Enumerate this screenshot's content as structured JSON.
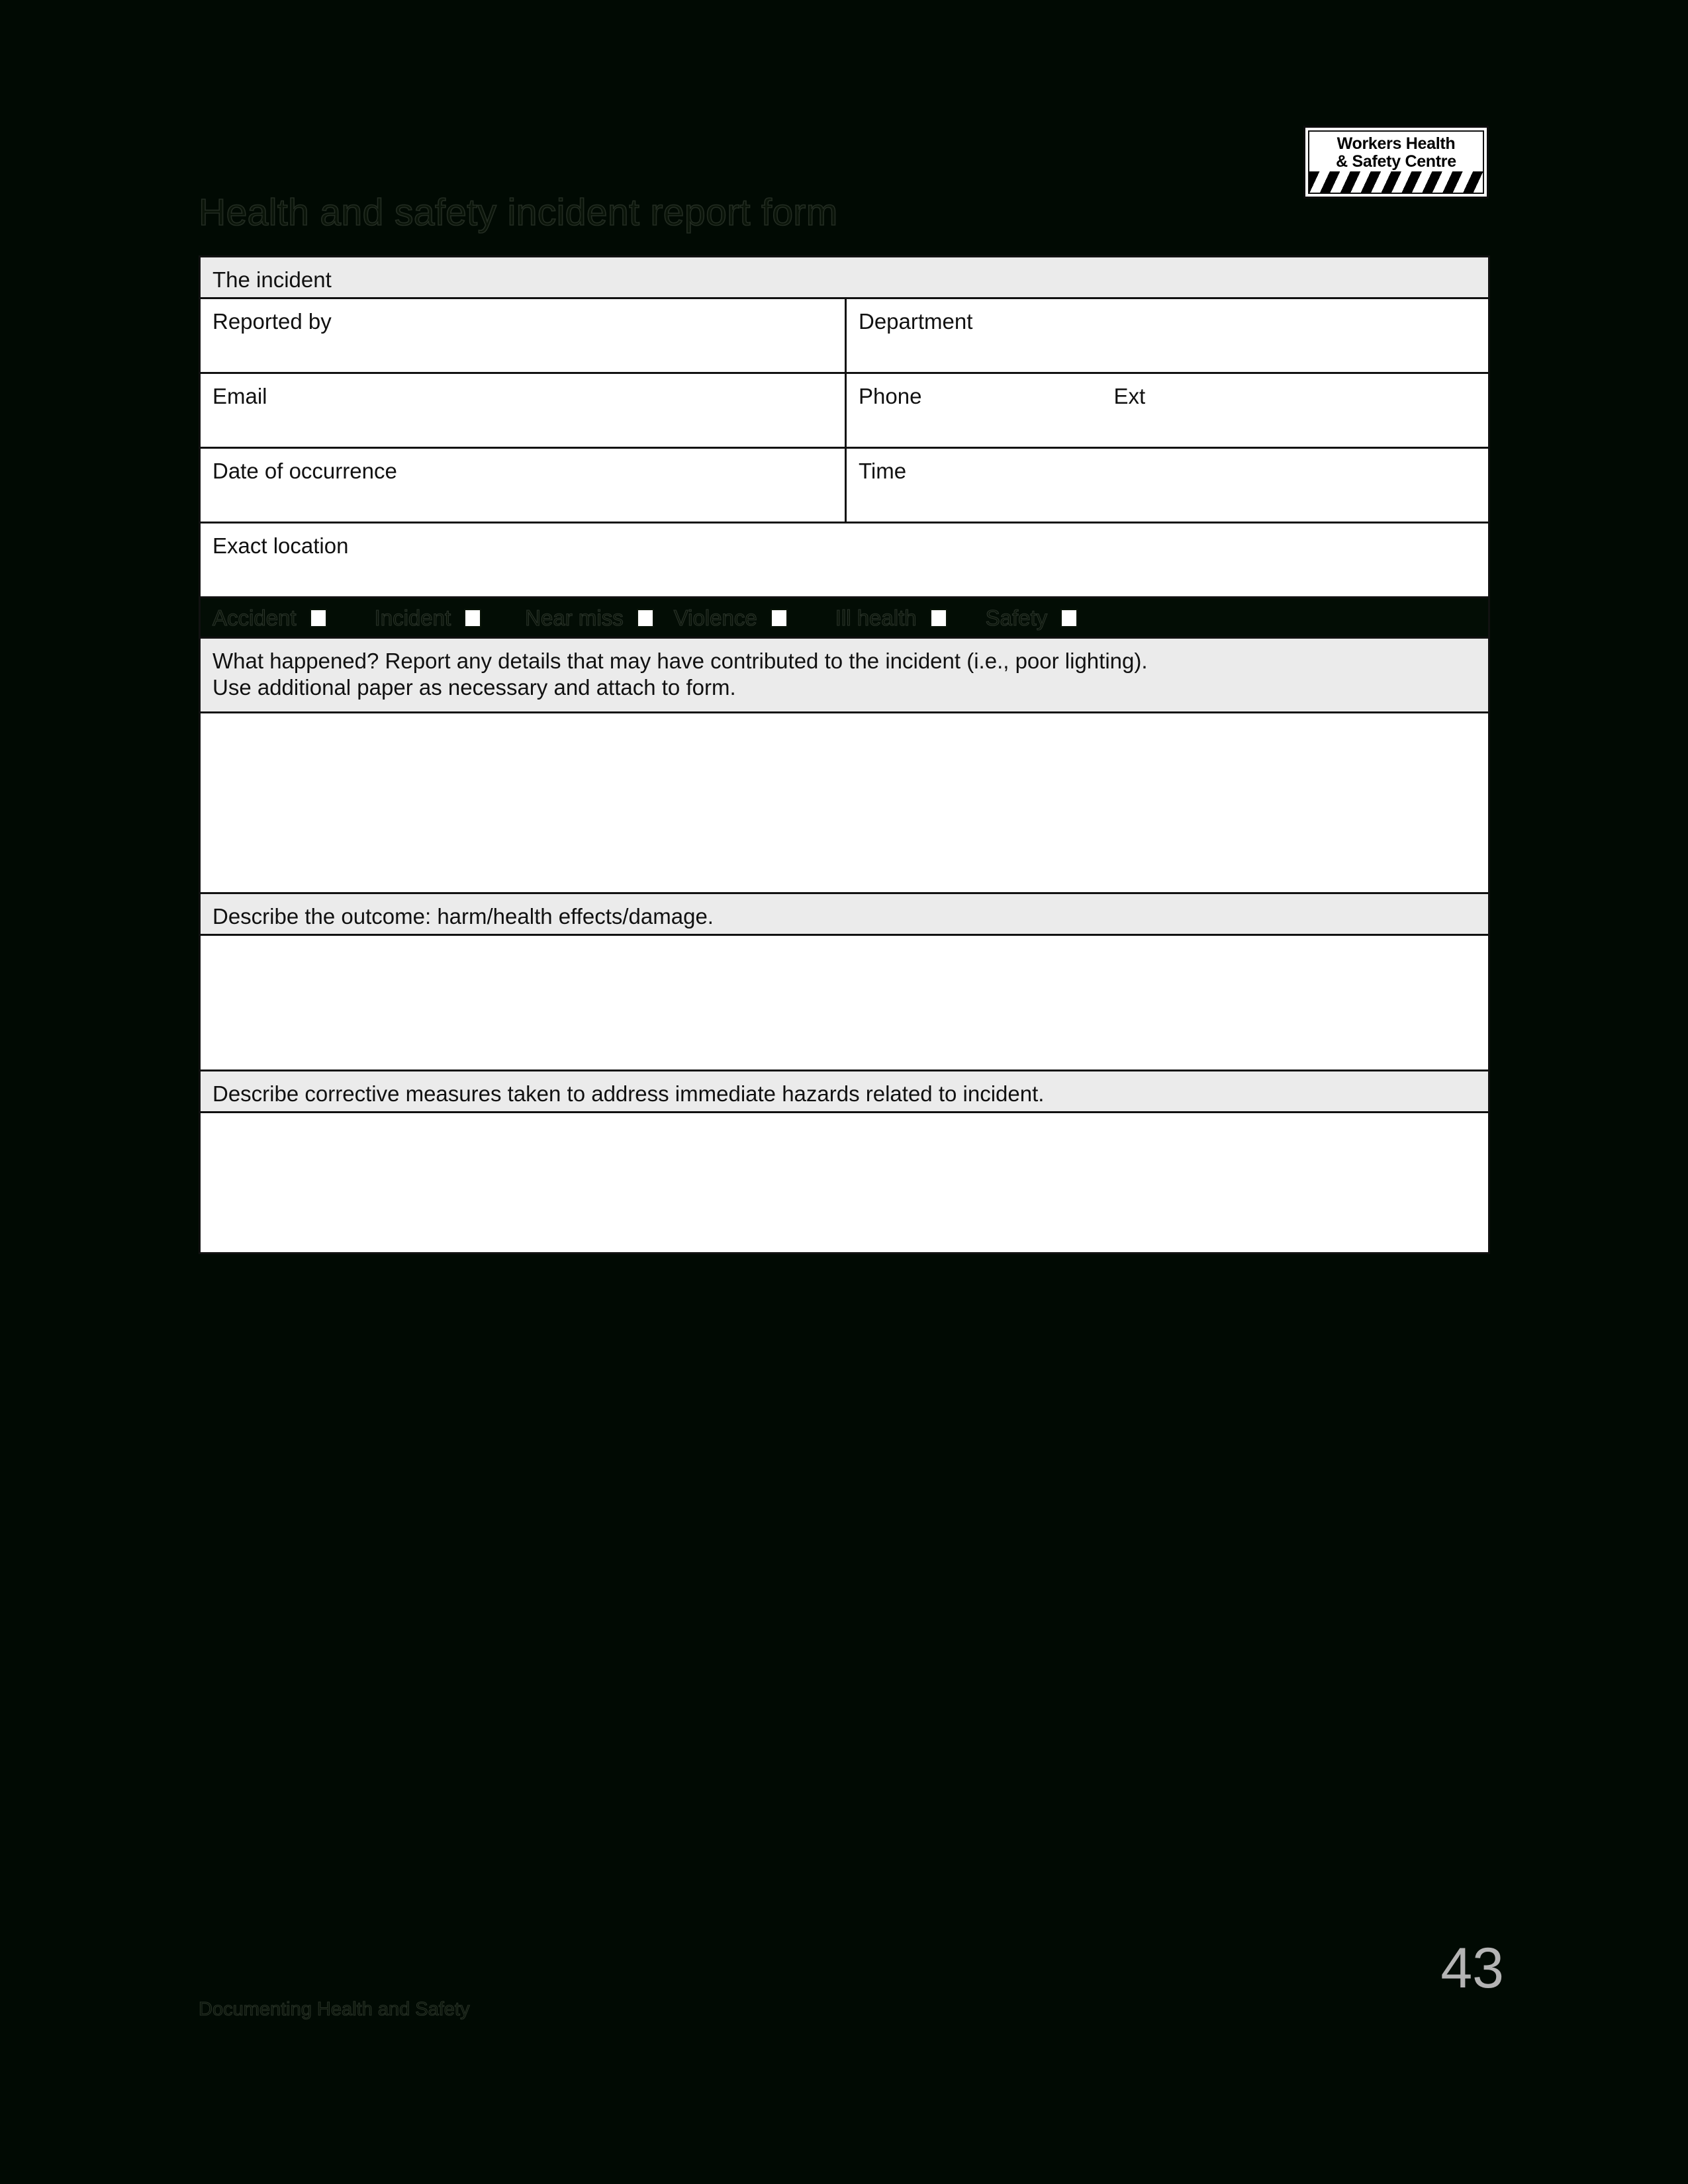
{
  "document": {
    "title": "Health and safety incident report form",
    "page_number": "43",
    "footer": "Documenting Health and Safety"
  },
  "logo": {
    "line1": "Workers Health",
    "line2": "& Safety Centre",
    "stripe_colors": [
      "#000000",
      "#ffffff"
    ]
  },
  "colors": {
    "page_background": "#010a03",
    "section_header_background": "#ebebeb",
    "field_background": "#ffffff",
    "border": "#111111",
    "page_number": "#b4b4b4"
  },
  "form": {
    "section_header": "The incident",
    "fields": {
      "reported_by": "Reported by",
      "department": "Department",
      "email": "Email",
      "phone": "Phone",
      "ext": "Ext",
      "date_of_occurrence": "Date of occurrence",
      "time": "Time",
      "exact_location": "Exact location"
    },
    "incident_types": [
      {
        "label": "Accident",
        "checked": false
      },
      {
        "label": "Incident",
        "checked": false
      },
      {
        "label": "Near miss",
        "checked": false
      },
      {
        "label": "Violence",
        "checked": false
      },
      {
        "label": "Ill health",
        "checked": false
      },
      {
        "label": "Safety",
        "checked": false
      }
    ],
    "prompts": {
      "what_happened_line1": "What happened? Report any details that may have contributed to the incident (i.e., poor lighting).",
      "what_happened_line2": "Use additional paper as necessary and attach to form.",
      "outcome": "Describe the outcome: harm/health effects/damage.",
      "corrective": "Describe corrective measures taken to address immediate hazards related to incident."
    },
    "answers": {
      "what_happened": "",
      "outcome": "",
      "corrective": ""
    }
  }
}
